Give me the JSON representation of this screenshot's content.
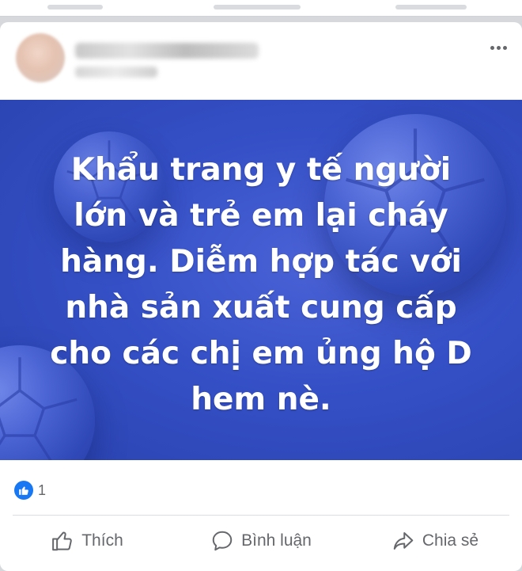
{
  "post": {
    "text_lines": [
      "Khẩu trang y tế người",
      "lớn và trẻ em lại cháy",
      "hàng. Diễm hợp tác với",
      "nhà sản xuất cung cấp",
      "cho các chị em ủng hộ D",
      "hem nè."
    ],
    "background_color": "#3550c6",
    "reaction_count": "1"
  },
  "actions": {
    "like_label": "Thích",
    "comment_label": "Bình luận",
    "share_label": "Chia sẻ"
  },
  "colors": {
    "like_blue": "#1877f2",
    "action_gray": "#65676b"
  }
}
